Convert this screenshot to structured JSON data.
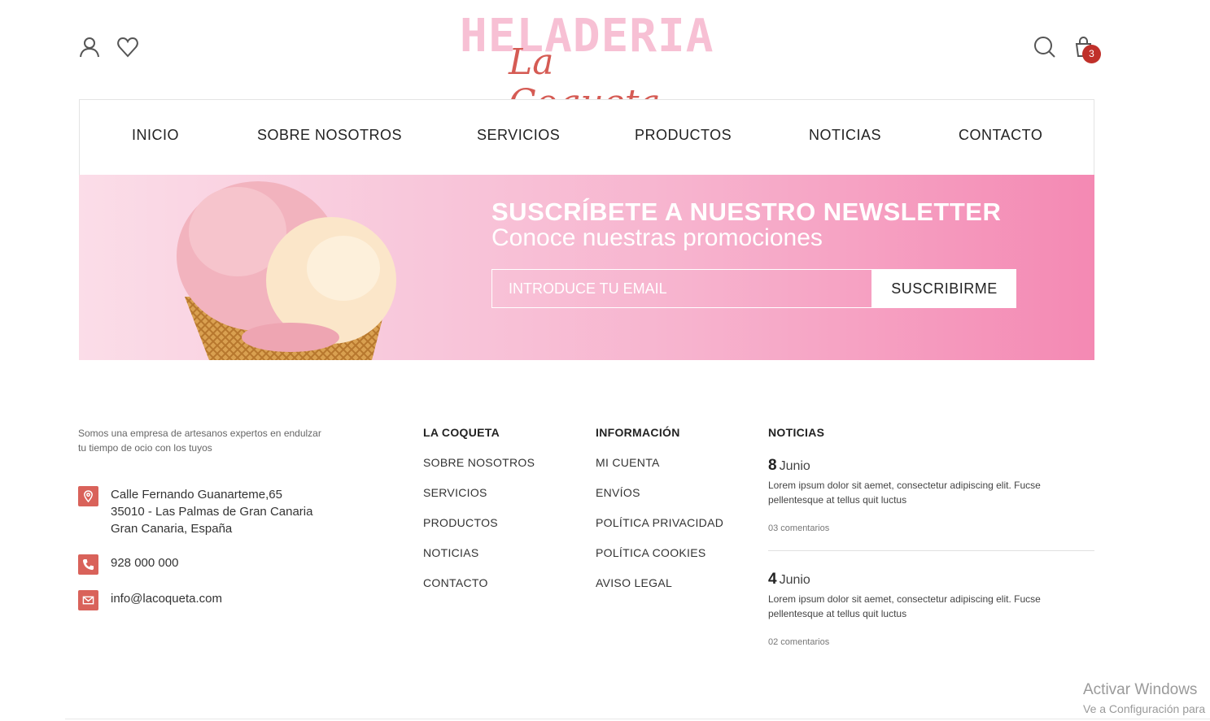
{
  "header": {
    "logo": {
      "line1": "HELADERIA",
      "line2": "La Coqueta"
    },
    "cart_count": "3",
    "icons": [
      "user-icon",
      "heart-icon",
      "search-icon",
      "cart-icon"
    ]
  },
  "nav": {
    "items": [
      {
        "label": "INICIO"
      },
      {
        "label": "SOBRE NOSOTROS"
      },
      {
        "label": "SERVICIOS"
      },
      {
        "label": "PRODUCTOS"
      },
      {
        "label": "NOTICIAS"
      },
      {
        "label": "CONTACTO"
      }
    ]
  },
  "newsletter": {
    "title": "SUSCRÍBETE A NUESTRO NEWSLETTER",
    "subtitle": "Conoce nuestras promociones",
    "email_placeholder": "INTRODUCE TU EMAIL",
    "button": "SUSCRIBIRME"
  },
  "footer": {
    "about": "Somos una empresa de artesanos expertos en endulzar tu tiempo de ocio con los tuyos",
    "address": [
      "Calle Fernando Guanarteme,65",
      "35010 - Las Palmas de Gran Canaria",
      "Gran Canaria, España"
    ],
    "phone": "928 000 000",
    "email": "info@lacoqueta.com",
    "col_coqueta": {
      "title": "LA COQUETA",
      "links": [
        "SOBRE NOSOTROS",
        "SERVICIOS",
        "PRODUCTOS",
        "NOTICIAS",
        "CONTACTO"
      ]
    },
    "col_info": {
      "title": "INFORMACIÓN",
      "links": [
        "MI CUENTA",
        "ENVÍOS",
        "POLÍTICA PRIVACIDAD",
        "POLÍTICA COOKIES",
        "AVISO LEGAL"
      ]
    },
    "col_news": {
      "title": "NOTICIAS",
      "items": [
        {
          "day": "8",
          "month": "Junio",
          "text": "Lorem ipsum dolor sit aemet, consectetur adipiscing elit. Fucse pellentesque at tellus quit luctus",
          "comments": "03 comentarios"
        },
        {
          "day": "4",
          "month": "Junio",
          "text": "Lorem ipsum dolor sit aemet, consectetur adipiscing elit. Fucse pellentesque at tellus quit luctus",
          "comments": "02 comentarios"
        }
      ]
    }
  },
  "watermark": {
    "line1": "Activar Windows",
    "line2": "Ve a Configuración para"
  },
  "colors": {
    "accent": "#d9625a",
    "pink": "#f489b3",
    "badge": "#c0302a"
  }
}
